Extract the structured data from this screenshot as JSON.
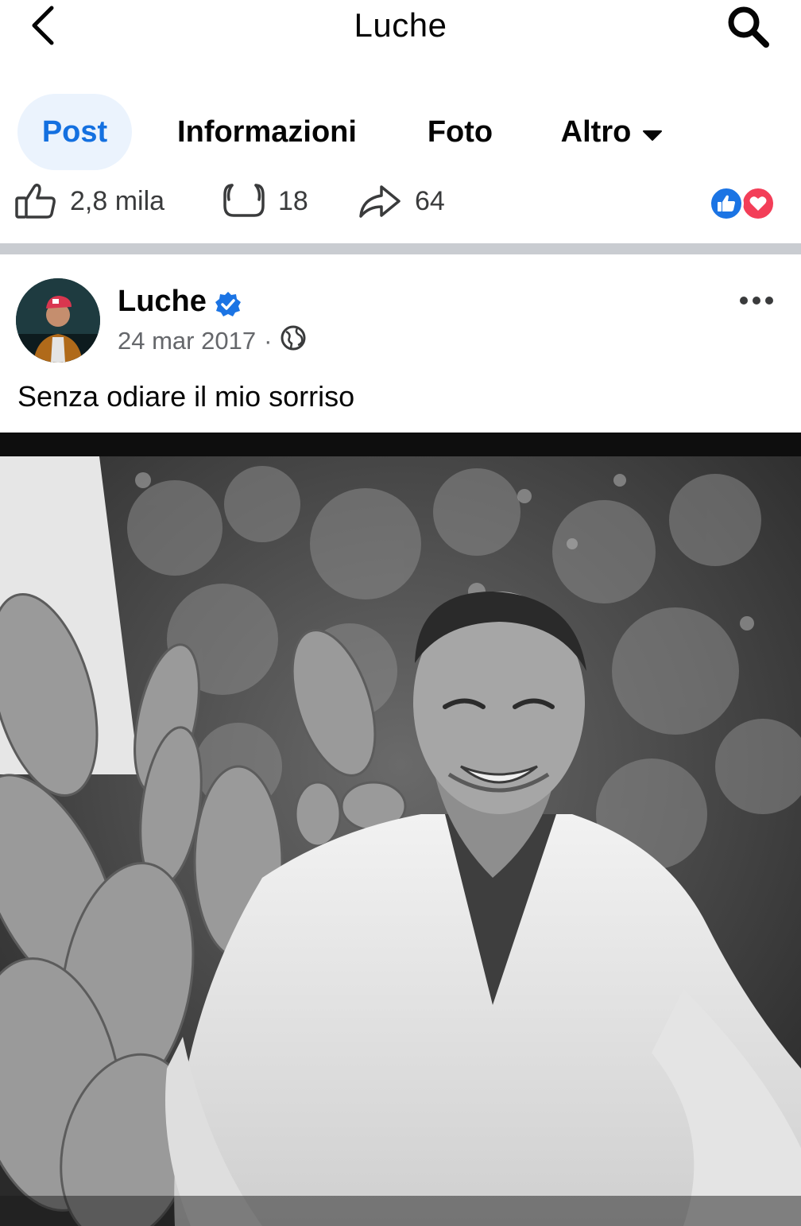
{
  "header": {
    "title": "Luche",
    "back_icon": "chevron-left-icon",
    "search_icon": "search-icon"
  },
  "tabs": [
    {
      "label": "Post",
      "active": true
    },
    {
      "label": "Informazioni",
      "active": false
    },
    {
      "label": "Foto",
      "active": false
    },
    {
      "label": "Altro",
      "active": false,
      "dropdown": true
    }
  ],
  "stats": {
    "likes": "2,8 mila",
    "comments": "18",
    "shares": "64",
    "reactions": [
      "like",
      "love"
    ]
  },
  "post": {
    "author": "Luche",
    "verified": true,
    "date": "24 mar 2017",
    "separator": "·",
    "audience_icon": "globe-icon",
    "caption": "Senza odiare il mio sorriso",
    "photo_description_icon": "photo"
  },
  "colors": {
    "accent": "#1470e0",
    "active_tab_bg": "#ebf3fd",
    "like_blue": "#1b74e4",
    "love_red": "#f33e58",
    "secondary_text": "#65676b"
  }
}
